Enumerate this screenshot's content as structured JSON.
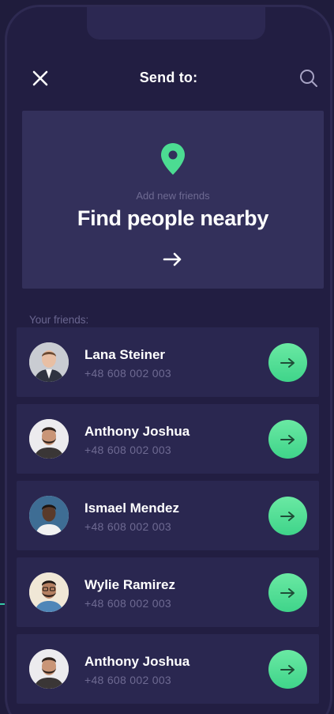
{
  "header": {
    "title": "Send to:",
    "close_icon": "close-icon",
    "search_icon": "search-icon"
  },
  "nearby_card": {
    "subtitle": "Add new friends",
    "title": "Find people nearby",
    "arrow_glyph": "→",
    "pin_icon": "location-pin-icon"
  },
  "friends_section": {
    "label": "Your friends:"
  },
  "friends": [
    {
      "name": "Lana Steiner",
      "phone": "+48 608 002 003"
    },
    {
      "name": "Anthony Joshua",
      "phone": "+48 608 002 003"
    },
    {
      "name": "Ismael Mendez",
      "phone": "+48 608 002 003"
    },
    {
      "name": "Wylie Ramirez",
      "phone": "+48 608 002 003"
    },
    {
      "name": "Anthony Joshua",
      "phone": "+48 608 002 003"
    }
  ],
  "colors": {
    "background": "#221e42",
    "card": "#33305b",
    "row": "#2a2750",
    "accent": "#4cdc92",
    "muted_text": "#6e6a92"
  }
}
